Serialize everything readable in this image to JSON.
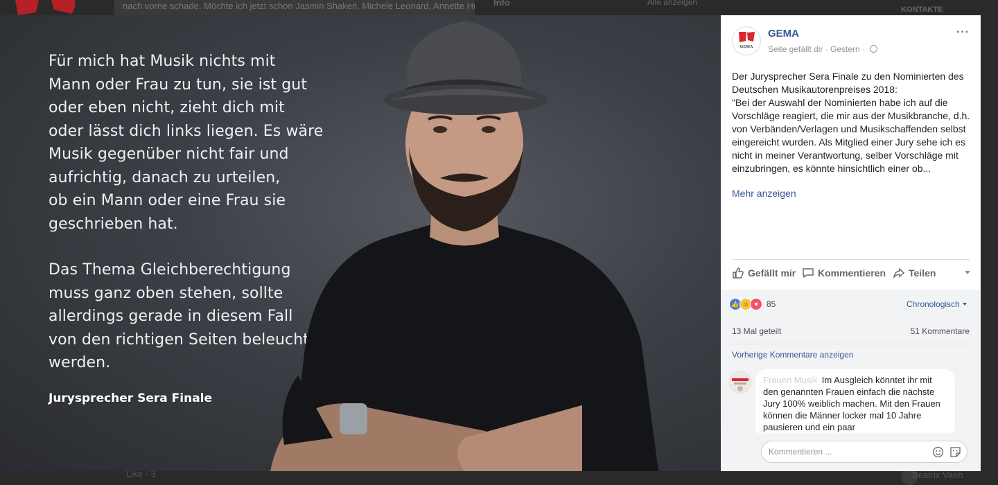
{
  "background": {
    "top_text": "nach vorne schade. Möchte ich jetzt schon Jasmin Shakeri, Michele Leonard, Annette Humpe, Inga Humpe, Balbina, Arezu Weitholz, Jennifer",
    "info_label": "Info",
    "show_all": "Alle anzeigen",
    "contacts": "KONTAKTE",
    "bottom_left": "Like · 3",
    "bottom_right": "Beatrix Vaeh"
  },
  "photo": {
    "quote_p1": "Für mich hat Musik nichts mit\nMann oder Frau zu tun, sie ist gut\noder eben nicht, zieht dich mit\noder lässt dich links liegen. Es wäre\nMusik gegenüber nicht fair und\naufrichtig, danach zu urteilen,\nob ein Mann oder eine Frau sie\ngeschrieben hat.",
    "quote_p2": "Das Thema Gleichberechtigung\nmuss ganz oben stehen, sollte\nallerdings gerade in diesem Fall\nvon den richtigen Seiten beleuchtet\nwerden.",
    "author": "Jurysprecher Sera Finale"
  },
  "post": {
    "page_name": "GEMA",
    "meta": "Seite gefällt dir · Gestern · ",
    "more": "···",
    "text": "Der Jurysprecher Sera Finale zu den Nominierten des Deutschen Musikautorenpreises 2018:\n\"Bei der Auswahl der Nominierten habe ich auf die Vorschläge reagiert, die mir aus der Musikbranche, d.h. von Verbänden/Verlagen und Musikschaffenden selbst eingereicht wurden. Als Mitglied einer Jury sehe ich es nicht in meiner Verantwortung, selber Vorschläge mit einzubringen, es könnte hinsichtlich einer ob...",
    "show_more": "Mehr anzeigen",
    "like_label": "Gefällt mir",
    "comment_label": "Kommentieren",
    "share_label": "Teilen"
  },
  "stats": {
    "reaction_count": "85",
    "sort_label": "Chronologisch",
    "shared": "13 Mal geteilt",
    "comments": "51 Kommentare",
    "previous": "Vorherige Kommentare anzeigen"
  },
  "comment": {
    "author": "Frauen Musik",
    "text": "Im Ausgleich könntet ihr mit den genannten Frauen einfach die nächste Jury 100% weiblich machen. Mit den Frauen können die Männer locker mal 10 Jahre pausieren und ein paar"
  },
  "composer": {
    "placeholder": "Kommentieren ..."
  },
  "colors": {
    "link": "#385898",
    "brand_red": "#d8262f",
    "photo_bg": "#3c3f45"
  }
}
